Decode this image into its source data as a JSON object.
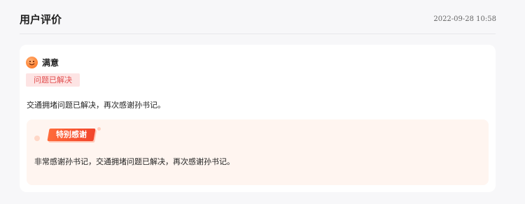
{
  "header": {
    "title": "用户评价",
    "timestamp": "2022-09-28 10:58"
  },
  "rating": {
    "icon": "smile-face-icon",
    "label": "满意",
    "tag": "问题已解决"
  },
  "review": {
    "content": "交通拥堵问题已解决，再次感谢孙书记。"
  },
  "special_thanks": {
    "badge": "特别感谢",
    "content": "非常感谢孙书记，交通拥堵问题已解决，再次感谢孙书记。"
  },
  "colors": {
    "accent_red": "#f2452b",
    "tag_text": "#e14d4d",
    "tag_bg": "#fde4e4",
    "thanks_bg": "#fff5f0"
  }
}
